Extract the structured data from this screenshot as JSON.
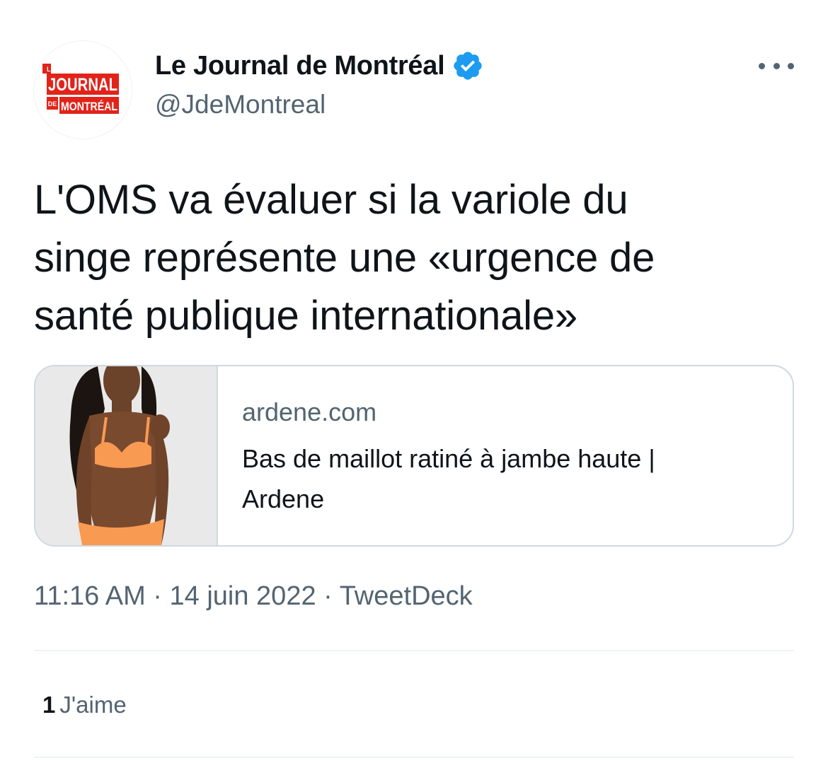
{
  "author": {
    "avatar_text": {
      "small_top": "LE",
      "main": "JOURNAL",
      "small_bottom": "DE",
      "bottom": "MONTRÉAL"
    },
    "display_name": "Le Journal de Montréal",
    "handle": "@JdeMontreal",
    "verified": true
  },
  "tweet": {
    "lines": [
      "L'OMS va évaluer si la variole du",
      "singe représente une «urgence de",
      "santé publique internationale»"
    ]
  },
  "card": {
    "domain": "ardene.com",
    "title_lines": [
      "Bas de maillot ratiné à jambe haute |",
      "Ardene"
    ]
  },
  "meta": {
    "time": "11:16 AM",
    "sep": "·",
    "date": "14 juin 2022",
    "source": "TweetDeck"
  },
  "stats": {
    "likes_count": "1",
    "likes_label": "J'aime"
  },
  "colors": {
    "brand_red": "#e2231a",
    "verified_blue": "#1d9bf0",
    "secondary_text": "#536471",
    "primary_text": "#0f1419",
    "card_border": "#cfd9de",
    "bikini_orange": "#f99a52"
  }
}
